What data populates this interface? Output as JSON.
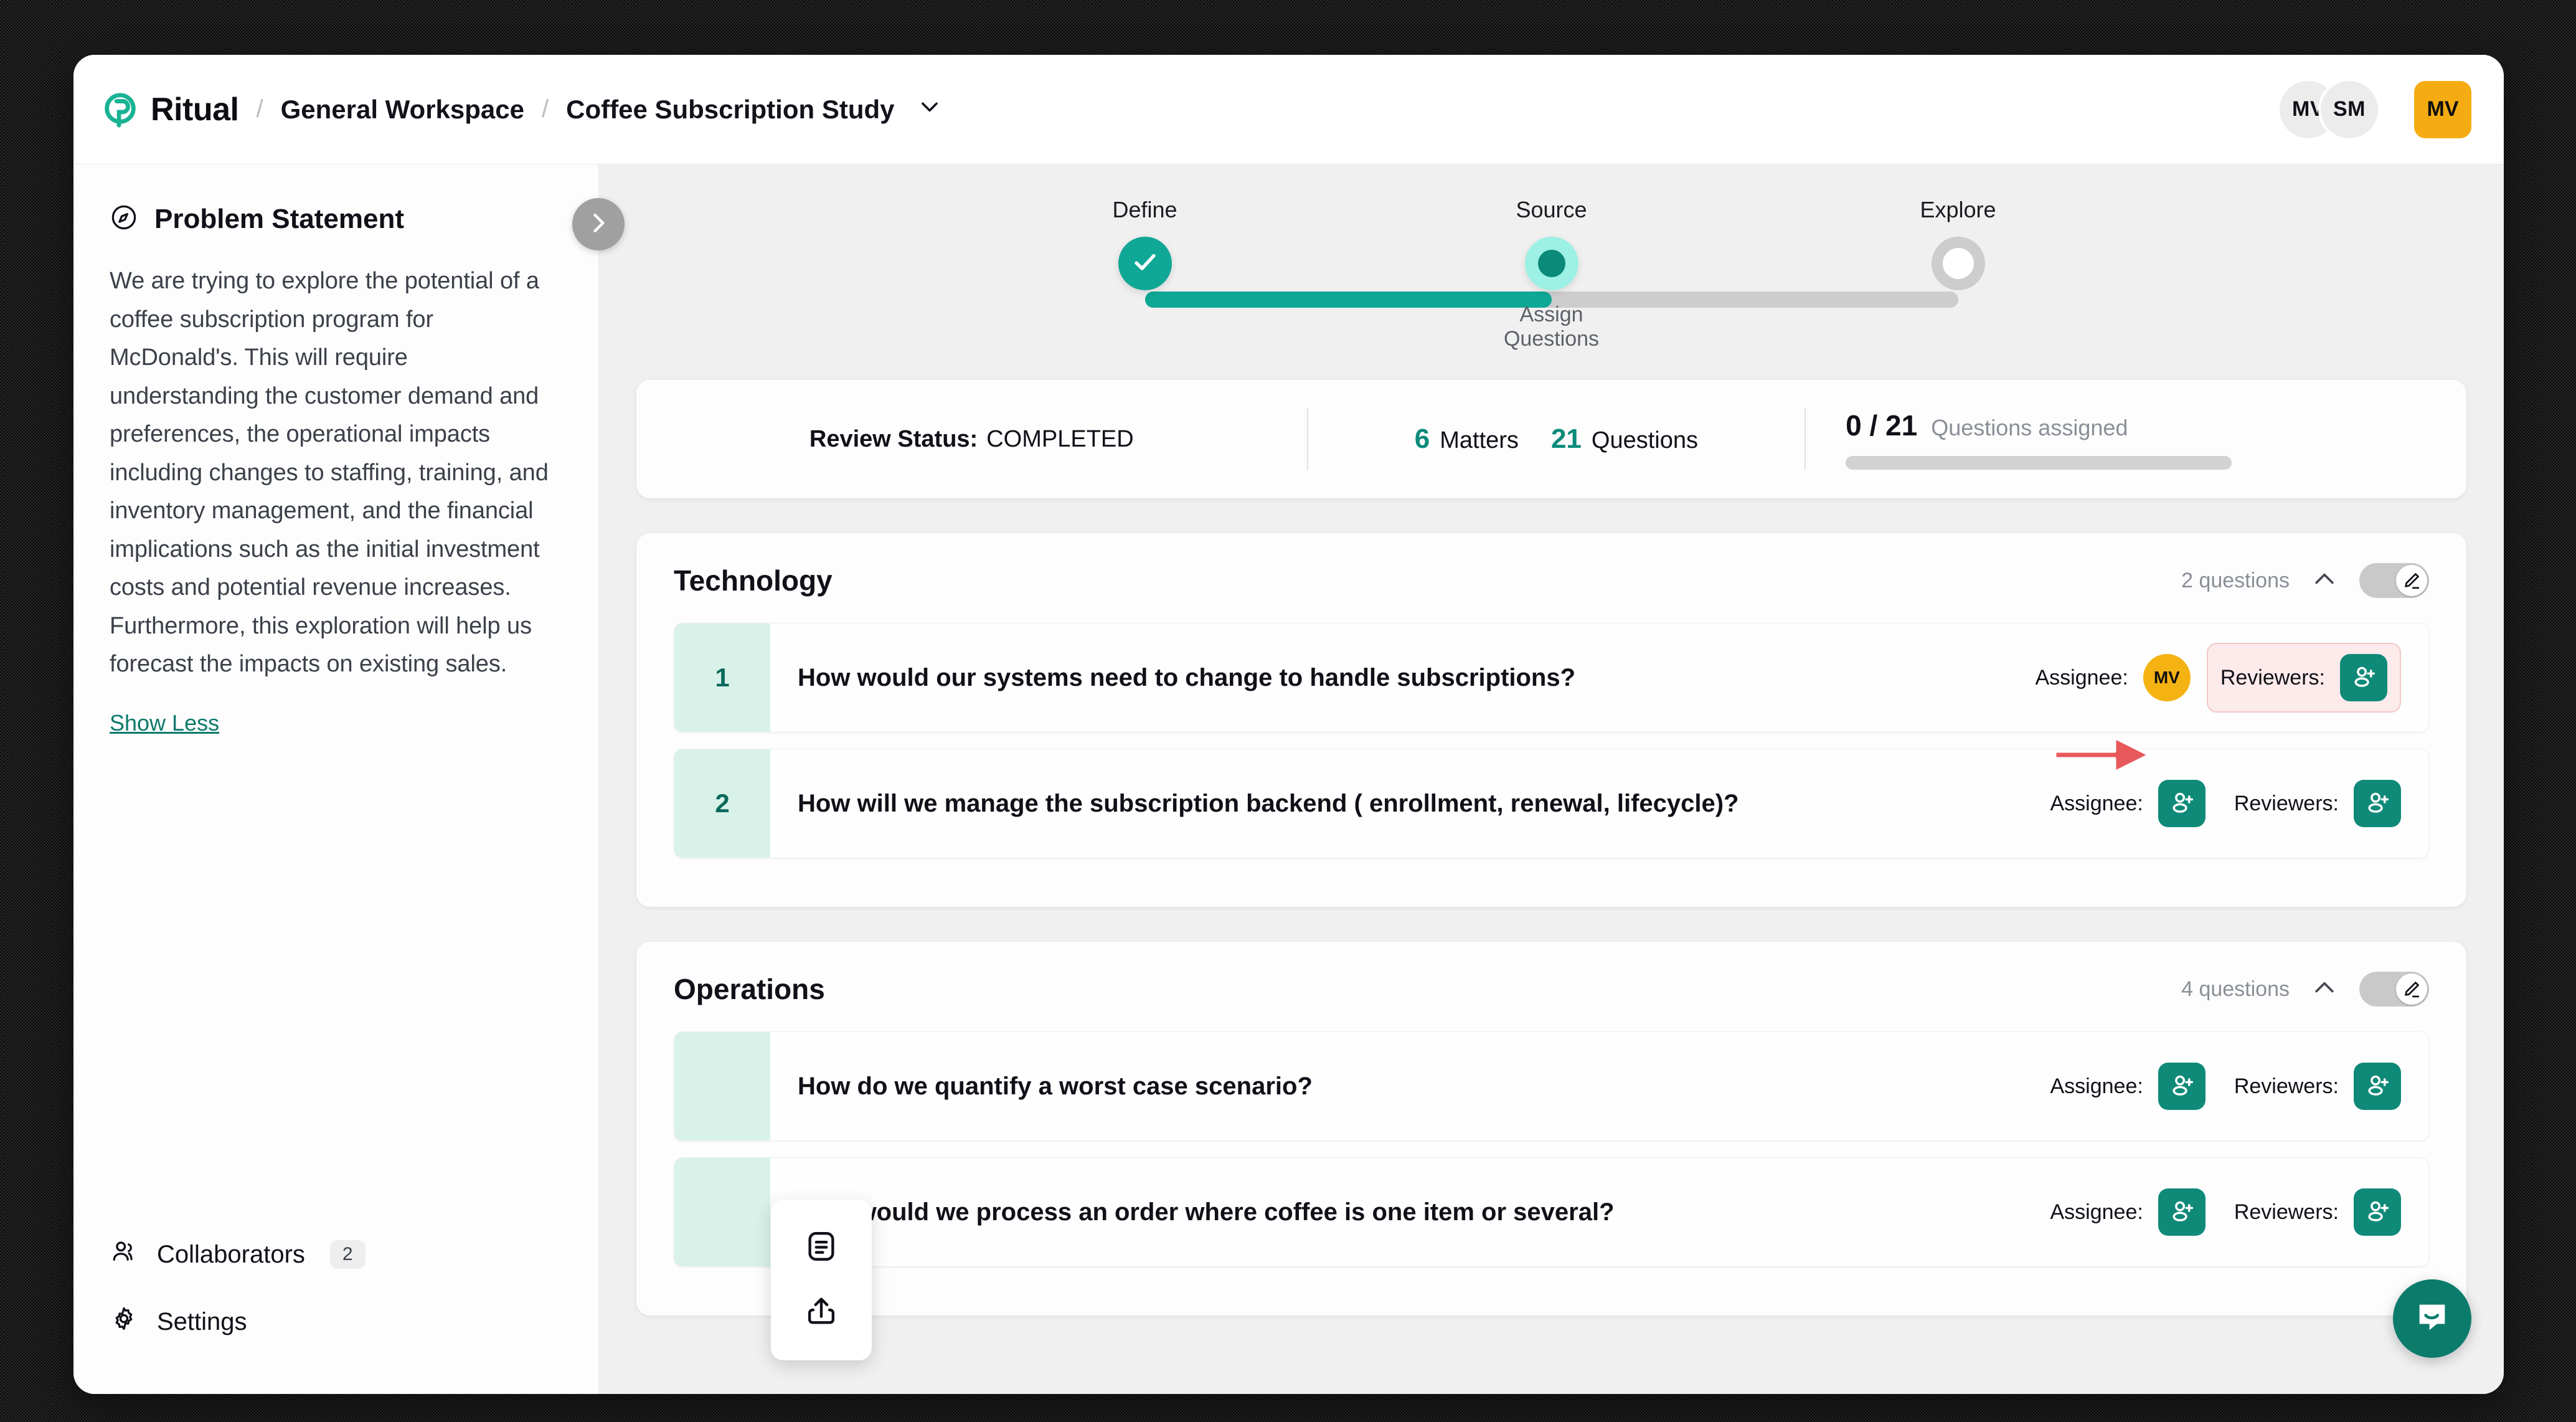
{
  "app": {
    "brand_name": "Ritual",
    "brand_icon": "ritual-logo-icon"
  },
  "breadcrumb": {
    "separator": "/",
    "workspace": "General Workspace",
    "project": "Coffee Subscription Study",
    "chevron": "∨"
  },
  "header_avatars": {
    "circles": [
      "MV",
      "SM"
    ],
    "current_user": "MV",
    "current_user_color": "#f5ac13"
  },
  "sidebar": {
    "panel_icon": "compass-icon",
    "panel_title": "Problem Statement",
    "problem_statement": "We are trying to explore the potential of a coffee subscription program for McDonald's. This will require understanding the customer demand and preferences, the operational impacts including changes to staffing, training, and inventory management, and the financial implications such as the initial investment costs and potential revenue increases. Furthermore, this exploration will help us forecast the impacts on existing sales.",
    "show_less_label": "Show Less",
    "collapse_icon": "chevron-right-icon",
    "bottom_items": [
      {
        "icon": "users-icon",
        "label": "Collaborators",
        "badge": "2"
      },
      {
        "icon": "gear-icon",
        "label": "Settings",
        "badge": ""
      }
    ]
  },
  "stepper": {
    "steps": [
      {
        "label": "Define",
        "state": "done",
        "sublabel": ""
      },
      {
        "label": "Source",
        "state": "current",
        "sublabel": "Assign Questions"
      },
      {
        "label": "Explore",
        "state": "todo",
        "sublabel": ""
      }
    ],
    "accent": "#0fa796"
  },
  "status_bar": {
    "review_status_label": "Review Status:",
    "review_status_value": "COMPLETED",
    "matters_count": "6",
    "matters_label": "Matters",
    "questions_count": "21",
    "questions_label": "Questions",
    "assigned_count": "0 / 21",
    "assigned_label": "Questions assigned",
    "progress_percent": 0
  },
  "sections": [
    {
      "title": "Technology",
      "question_count_label": "2 questions",
      "collapse_icon": "chevron-up-icon",
      "toggle_icon": "pencil-icon",
      "questions": [
        {
          "number": "1",
          "text": "How would our systems need to change to handle subscriptions?",
          "assignee_label": "Assignee:",
          "assignee_avatar": "MV",
          "assignee_has_user": true,
          "reviewers_label": "Reviewers:",
          "reviewers_icon": "add-person-icon",
          "highlighted": true
        },
        {
          "number": "2",
          "text": "How will we manage the subscription backend ( enrollment, renewal, lifecycle)?",
          "assignee_label": "Assignee:",
          "assignee_icon": "add-person-icon",
          "assignee_has_user": false,
          "reviewers_label": "Reviewers:",
          "reviewers_icon": "add-person-icon",
          "highlighted": false
        }
      ]
    },
    {
      "title": "Operations",
      "question_count_label": "4 questions",
      "collapse_icon": "chevron-up-icon",
      "toggle_icon": "pencil-icon",
      "questions": [
        {
          "number": "",
          "text": "How do we quantify a worst case scenario?",
          "assignee_label": "Assignee:",
          "assignee_icon": "add-person-icon",
          "assignee_has_user": false,
          "reviewers_label": "Reviewers:",
          "reviewers_icon": "add-person-icon",
          "highlighted": false
        },
        {
          "number": "",
          "text": "How would we process an order where coffee is one item or several?",
          "assignee_label": "Assignee:",
          "assignee_icon": "add-person-icon",
          "assignee_has_user": false,
          "reviewers_label": "Reviewers:",
          "reviewers_icon": "add-person-icon",
          "highlighted": false
        }
      ]
    }
  ],
  "float_tools": [
    {
      "icon": "notes-icon"
    },
    {
      "icon": "share-icon"
    }
  ],
  "chat_widget": {
    "icon": "chat-icon",
    "color": "#0b7c6c"
  },
  "annotation": {
    "type": "red-arrow",
    "color": "#e8595b"
  }
}
